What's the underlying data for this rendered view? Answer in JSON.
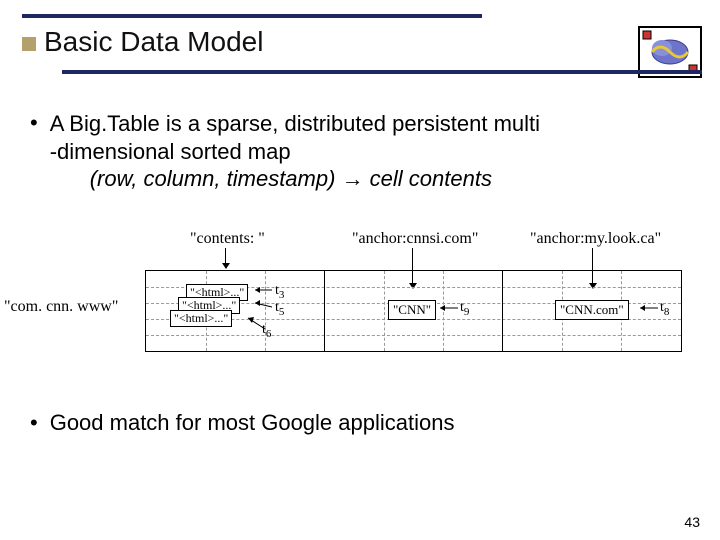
{
  "title": "Basic Data Model",
  "bullet1_line1": "A Big.Table is a sparse, distributed persistent multi",
  "bullet1_line2": "-dimensional sorted map",
  "map_tuple": "(row, column, timestamp)",
  "map_arrow": "→",
  "map_result": " cell contents",
  "columns": {
    "contents": "\"contents: \"",
    "anchor1": "\"anchor:cnnsi.com\"",
    "anchor2": "\"anchor:my.look.ca\""
  },
  "row_key": "\"com. cnn. www\"",
  "cell_stack": {
    "a": "\"<html>...\"",
    "b": "\"<html>...\"",
    "c": "\"<html>...\""
  },
  "timestamps": {
    "t3": "t",
    "t3s": "3",
    "t5": "t",
    "t5s": "5",
    "t6": "t",
    "t6s": "6",
    "t9": "t",
    "t9s": "9",
    "t8": "t",
    "t8s": "8"
  },
  "cell_cnn": "\"CNN\"",
  "cell_cnncom": "\"CNN.com\"",
  "bullet2": "Good match for most Google applications",
  "page": "43"
}
